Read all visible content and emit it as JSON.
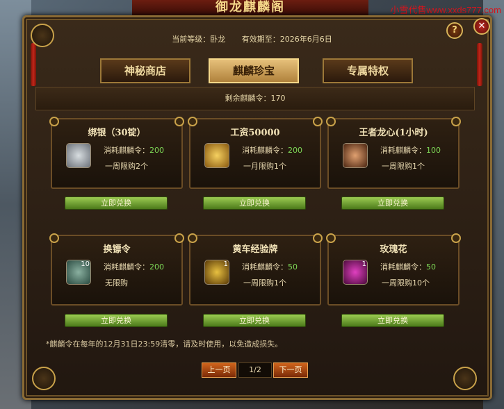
{
  "banner": {
    "title": "御龙麒麟阁"
  },
  "watermark": "小雪代售www.xxds777.com",
  "header": {
    "level": "当前等级：卧龙",
    "expiry": "有效期至：2026年6月6日",
    "help_label": "?",
    "close_label": "✕"
  },
  "tabs": [
    {
      "label": "神秘商店",
      "active": false
    },
    {
      "label": "麒麟珍宝",
      "active": true
    },
    {
      "label": "专属特权",
      "active": false
    }
  ],
  "remaining": "剩余麒麟令：170",
  "items": [
    {
      "name": "绑银（30锭）",
      "icon": "silver-ingot-icon",
      "qty": "",
      "cost_label": "消耗麒麟令：",
      "cost": "200",
      "limit": "一周限购2个",
      "button": "立即兑换"
    },
    {
      "name": "工资50000",
      "icon": "gold-scroll-icon",
      "qty": "",
      "cost_label": "消耗麒麟令：",
      "cost": "200",
      "limit": "一月限购1个",
      "button": "立即兑换"
    },
    {
      "name": "王者龙心(1小时)",
      "icon": "dragon-heart-icon",
      "qty": "",
      "cost_label": "消耗麒麟令：",
      "cost": "100",
      "limit": "一周限购1个",
      "button": "立即兑换"
    },
    {
      "name": "换镖令",
      "icon": "escort-token-icon",
      "qty": "10",
      "cost_label": "消耗麒麟令：",
      "cost": "200",
      "limit": "无限购",
      "button": "立即兑换"
    },
    {
      "name": "黄车经验牌",
      "icon": "yellow-cart-icon",
      "qty": "1",
      "cost_label": "消耗麒麟令：",
      "cost": "50",
      "limit": "一周限购1个",
      "button": "立即兑换"
    },
    {
      "name": "玫瑰花",
      "icon": "rose-icon",
      "qty": "1",
      "cost_label": "消耗麒麟令：",
      "cost": "50",
      "limit": "一周限购10个",
      "button": "立即兑换"
    }
  ],
  "note": "*麒麟令在每年的12月31日23:59清零，请及时使用，以免造成损失。",
  "pager": {
    "prev": "上一页",
    "page": "1/2",
    "next": "下一页"
  }
}
